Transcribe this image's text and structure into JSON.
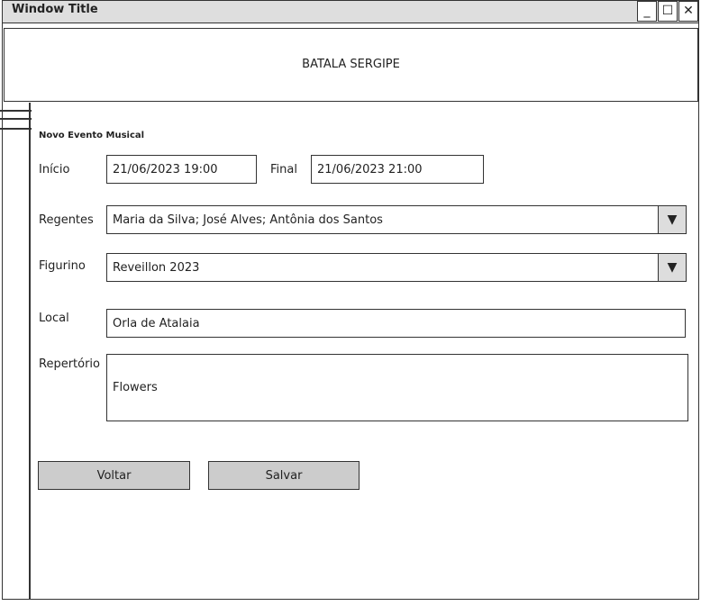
{
  "window": {
    "title": "Window Title",
    "minimize": "_",
    "maximize": "☐",
    "close": "✕"
  },
  "header": {
    "title": "BATALA SERGIPE"
  },
  "form": {
    "heading": "Novo Evento Musical",
    "inicio": {
      "label": "Início",
      "value": "21/06/2023 19:00"
    },
    "final": {
      "label": "Final",
      "value": "21/06/2023 21:00"
    },
    "regentes": {
      "label": "Regentes",
      "value": "Maria da Silva; José Alves; Antônia dos Santos",
      "arrow": "▼"
    },
    "figurino": {
      "label": "Figurino",
      "value": "Reveillon 2023",
      "arrow": "▼"
    },
    "local": {
      "label": "Local",
      "value": "Orla de Atalaia"
    },
    "repertorio": {
      "label": "Repertório",
      "value": "Flowers"
    },
    "voltar": "Voltar",
    "salvar": "Salvar"
  }
}
